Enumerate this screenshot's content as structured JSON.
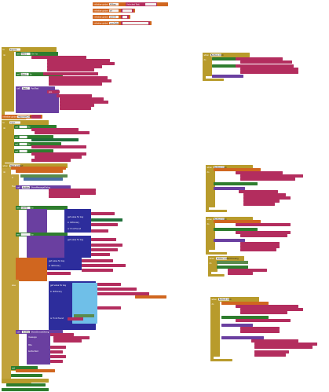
{
  "workspace": {
    "title": "Blocks editor workspace",
    "background": "#ffffff"
  },
  "colors": {
    "procedure": "#b89b2c",
    "procedure_dark": "#9c8322",
    "control": "#c1a23b",
    "variable": "#d0661f",
    "text": "#b32d5e",
    "text_field": "#f3f3f3",
    "component_set": "#2e7d2e",
    "component_get": "#1f6f3a",
    "dictionary": "#2d2d9c",
    "list": "#6fbfe8",
    "logic": "#5a8b4c",
    "math": "#4a6fa5",
    "any_component": "#6a3fa0",
    "event": "#6a3fa0"
  },
  "blocks": {
    "globals": [
      {
        "keyword": "initialize global",
        "name": "APIkey",
        "to": "to",
        "value": "Unlocked Text"
      },
      {
        "keyword": "initialize global",
        "name": "url",
        "to": "to",
        "value": ""
      },
      {
        "keyword": "initialize global",
        "name": "userID",
        "to": "to",
        "value": ""
      },
      {
        "keyword": "initialize global",
        "name": "userData",
        "to": "to",
        "value": ""
      }
    ],
    "proc_signup": {
      "keyword": "to",
      "name": "SignUp",
      "params": "do"
    },
    "proc_login": {
      "keyword": "to",
      "name": "Login",
      "params": "do"
    },
    "proc_got": {
      "keyword": "when",
      "name": "Web1.GotText",
      "params": "do"
    },
    "mid_global": {
      "keyword": "initialize global",
      "name": "responseContent",
      "to": "to"
    },
    "right_event_1": {
      "keyword": "when",
      "name": "Button1.Click"
    },
    "right_event_2": {
      "keyword": "when",
      "name": "Button2.Click"
    },
    "right_event_3": {
      "keyword": "when",
      "name": "Notifier1.AfterChoosing"
    },
    "right_event_4": {
      "keyword": "when",
      "name": "Button3.Click"
    },
    "snippets": {
      "set": "set",
      "call": "call",
      "to": "to",
      "do": "do",
      "if": "if",
      "then": "then",
      "else": "else",
      "join": "join",
      "url": "Url",
      "post_text": "PostText",
      "get": "get",
      "get_value": "get value for key",
      "in_dictionary": "in dictionary",
      "or_if_not_found": "or if not found",
      "show_message": "ShowMessageDialog",
      "show_choose": "ShowChooseDialog",
      "message": "message",
      "title": "title",
      "button_text": "buttonText"
    }
  }
}
